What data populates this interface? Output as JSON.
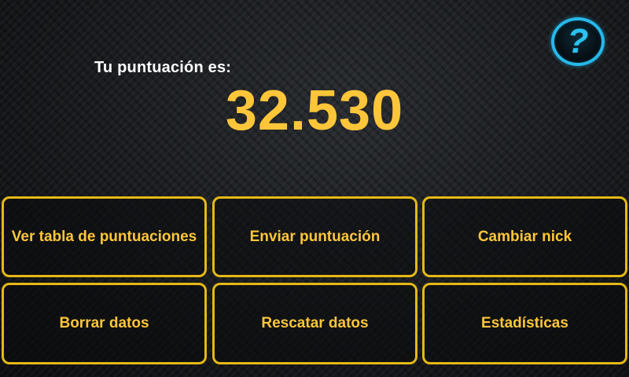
{
  "score": {
    "label": "Tu puntuación es:",
    "value": "32.530"
  },
  "help_button": {
    "glyph": "?",
    "icon": "help-question-icon",
    "color": "#26b9ea"
  },
  "menu": {
    "accent_color": "#e5b816",
    "buttons": [
      {
        "label": "Ver tabla de puntuaciones"
      },
      {
        "label": "Enviar puntuación"
      },
      {
        "label": "Cambiar nick"
      },
      {
        "label": "Borrar datos"
      },
      {
        "label": "Rescatar datos"
      },
      {
        "label": "Estadísticas"
      }
    ]
  }
}
